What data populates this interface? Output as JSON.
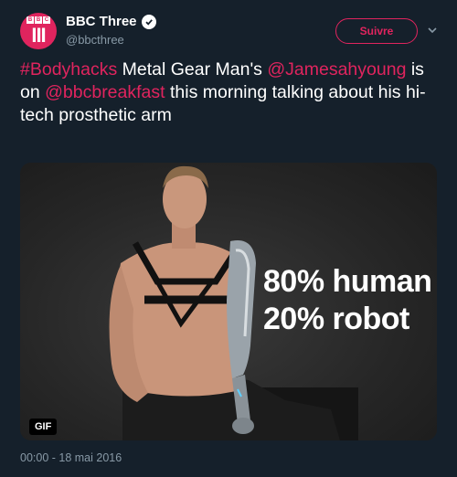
{
  "account": {
    "avatar_letters": [
      "B",
      "B",
      "C"
    ],
    "avatar_numeral": "III",
    "display_name": "BBC Three",
    "handle": "@bbcthree",
    "verified_icon": "verified-check-icon"
  },
  "follow_button": {
    "label": "Suivre"
  },
  "tweet": {
    "hashtag": "#Bodyhacks",
    "text_1": " Metal Gear Man's ",
    "mention_1": "@Jamesahyoung",
    "text_2": " is on ",
    "mention_2": "@bbcbreakfast",
    "text_3": " this morning talking about his hi-tech prosthetic arm"
  },
  "media": {
    "overlay_line_1": "80% human",
    "overlay_line_2": "20% robot",
    "badge": "GIF"
  },
  "timestamp": "00:00 - 18 mai 2016",
  "colors": {
    "background": "#15202b",
    "accent": "#e0245e",
    "muted": "#8899a6"
  }
}
